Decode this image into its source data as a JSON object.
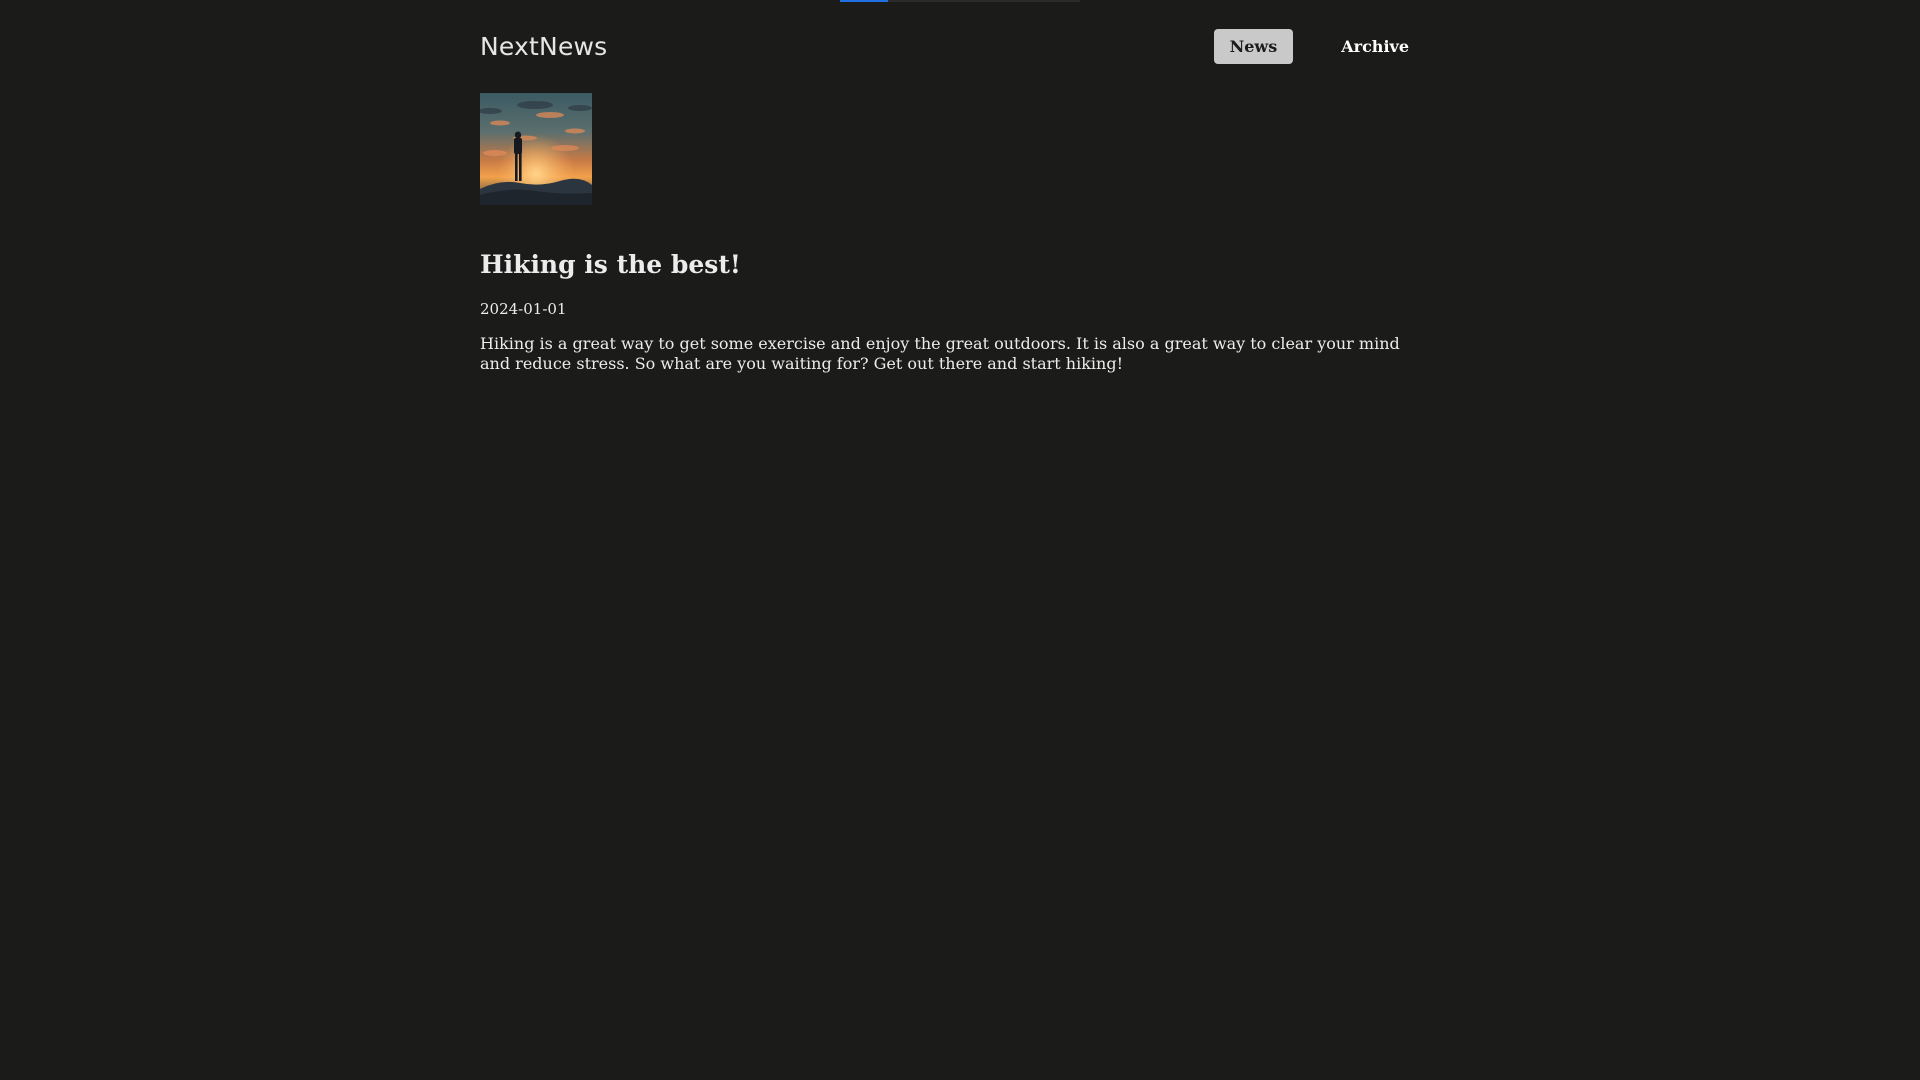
{
  "loading": {
    "progress": 0.2,
    "color": "#1f6fe5"
  },
  "header": {
    "logo": "NextNews",
    "nav": [
      {
        "label": "News",
        "active": true
      },
      {
        "label": "Archive",
        "active": false
      }
    ]
  },
  "article": {
    "image": {
      "icon": "hiker-sunset-image"
    },
    "title": "Hiking is the best!",
    "date": "2024-01-01",
    "body": "Hiking is a great way to get some exercise and enjoy the great outdoors. It is also a great way to clear your mind and reduce stress. So what are you waiting for? Get out there and start hiking!"
  },
  "colors": {
    "background": "#1b1b1a",
    "text": "#ececec",
    "nav_active_bg": "#c9c9c9"
  }
}
